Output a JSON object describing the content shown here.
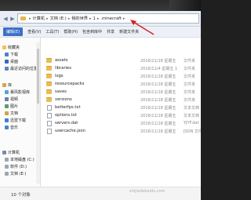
{
  "address": {
    "crumbs": [
      "计算机",
      "文档 (E:)",
      "我的世界",
      "1",
      ".minecraft"
    ]
  },
  "toolbar": {
    "items": [
      "编辑(E)",
      "查看(V)",
      "工具(T)",
      "帮助(H)",
      "包含到库中",
      "共享",
      "新建文件夹"
    ]
  },
  "sidebar": {
    "items": [
      {
        "label": "收藏夹",
        "color": "#f1c15a"
      },
      {
        "label": "下载",
        "color": "#4c7fd0"
      },
      {
        "label": "桌面",
        "color": "#3a6ab4"
      },
      {
        "label": "最近访问的位置",
        "color": "#5a86c4"
      },
      {
        "label": "",
        "color": ""
      },
      {
        "label": "库",
        "color": "#d3a649"
      },
      {
        "label": "暴风影视库",
        "color": "#5aa0d8"
      },
      {
        "label": "视频",
        "color": "#6a7fb0"
      },
      {
        "label": "图片",
        "color": "#5a9c6a"
      },
      {
        "label": "文档",
        "color": "#cfa24b"
      },
      {
        "label": "迅雷下载",
        "color": "#3c7ed6"
      },
      {
        "label": "音乐",
        "color": "#4a86c8"
      },
      {
        "label": "",
        "color": ""
      },
      {
        "label": "计算机",
        "color": "#7a8ea6"
      },
      {
        "label": "本地磁盘 (C:)",
        "color": "#9aa6b4"
      },
      {
        "label": "软件 (D:)",
        "color": "#9aa6b4"
      },
      {
        "label": "文档 (E:)",
        "color": "#9aa6b4"
      }
    ]
  },
  "files": [
    {
      "name": "assets",
      "date": "2016/11/18 星期五",
      "type": "文件夹",
      "kind": "folder"
    },
    {
      "name": "libraries",
      "date": "2016/11/4 星期五 1",
      "type": "文件夹",
      "kind": "folder"
    },
    {
      "name": "logs",
      "date": "2016/11/18 星期五",
      "type": "文件夹",
      "kind": "folder"
    },
    {
      "name": "resourcepacks",
      "date": "2016/11/18 星期五",
      "type": "文件夹",
      "kind": "folder"
    },
    {
      "name": "saves",
      "date": "2016/11/18 星期五",
      "type": "文件夹",
      "kind": "folder"
    },
    {
      "name": "versions",
      "date": "2016/11/18 星期五",
      "type": "文件夹",
      "kind": "folder"
    },
    {
      "name": "betterfps.txt",
      "date": "2016/11/18 星期五",
      "type": "文本文档",
      "kind": "file"
    },
    {
      "name": "options.txt",
      "date": "2016/11/18 星期五",
      "type": "文本文档",
      "kind": "file"
    },
    {
      "name": "servers.dat",
      "date": "2016/11/18 星期五",
      "type": "YJYF.dat",
      "kind": "file"
    },
    {
      "name": "usercache.json",
      "date": "2016/11/18 星期五",
      "type": "JSON 文件",
      "kind": "file"
    }
  ],
  "status": {
    "count_text": "10 个对象"
  },
  "watermark": "shijiedebaidu.com"
}
